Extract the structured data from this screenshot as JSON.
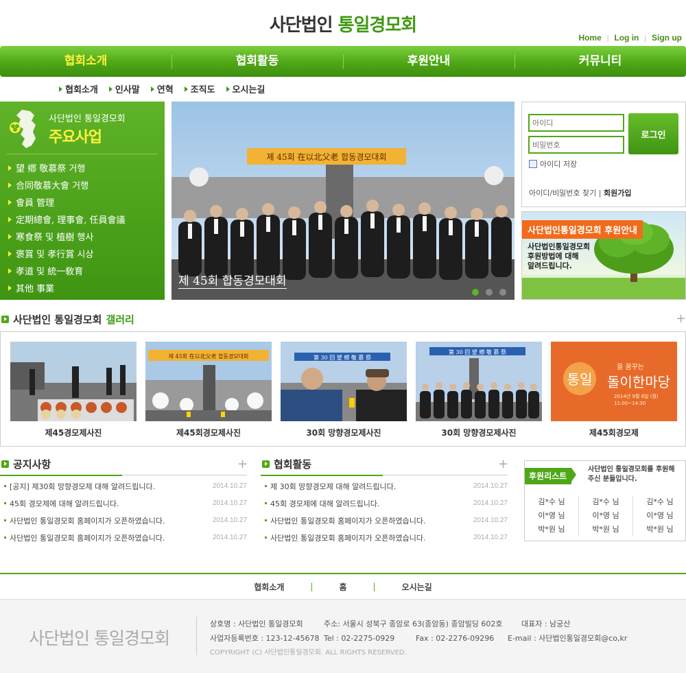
{
  "site": {
    "logo_dark": "사단법인",
    "logo_green": "통일경모회"
  },
  "toplinks": {
    "home": "Home",
    "login": "Log in",
    "signup": "Sign up"
  },
  "gnb": [
    {
      "label": "협회소개",
      "active": true
    },
    {
      "label": "협회활동",
      "active": false
    },
    {
      "label": "후원안내",
      "active": false
    },
    {
      "label": "커뮤니티",
      "active": false
    }
  ],
  "subnav": [
    "협회소개",
    "인사말",
    "연혁",
    "조직도",
    "오시는길"
  ],
  "business": {
    "subtitle": "사단법인 통일경모회",
    "title": "주요사업",
    "items": [
      "望 鄕 敬慕祭 거행",
      "合同敬慕大會 거행",
      "會員 管理",
      "定期總會, 理事會, 任員會議",
      "寒食祭 및 植樹 행사",
      "褒賞 및 孝行賞 시상",
      "孝道 및 統一敎育",
      "其他 事業"
    ]
  },
  "hero": {
    "caption": "제 45회 합동경모대회",
    "banner": "제 45회 在以北父老 합동경모대회",
    "active_slide": 1,
    "slides": 3
  },
  "login": {
    "id_placeholder": "아이디",
    "pw_placeholder": "비밀번호",
    "button": "로그인",
    "save_id": "아이디 저장",
    "find": "아이디/비밀번호 찾기",
    "join": "회원가입"
  },
  "sponsor": {
    "tag": "사단법인통일경모회 후원안내",
    "line1": "사단법인통일경모회",
    "line2": "후원방법에 대해",
    "line3": "알려드립니다."
  },
  "gallery": {
    "title_dark": "사단법인 통일경모회",
    "title_green": "갤러리",
    "items": [
      "제45경모제사진",
      "제45회경모제사진",
      "30회 망향경모제사진",
      "30회 망향경모제사진",
      "제45회경모제"
    ],
    "thumb_banner_45": "제 45회 在以北父老 합동경모대회",
    "thumb_banner_30": "第 30 回 望 鄕 敬 慕 祭",
    "thumb_poster_main": "통일",
    "thumb_poster_sub": "을 꿈꾸는",
    "thumb_poster_script": "돌이한마당",
    "thumb_poster_date": "2014년 9월 8일 (월)",
    "thumb_poster_time": "11:00~14:30"
  },
  "notice": {
    "title": "공지사항",
    "items": [
      {
        "title": "[공지] 제30회 망향경모제 대해 알려드립니다.",
        "date": "2014.10.27"
      },
      {
        "title": "45회 경모제에 대해 알려드립니다.",
        "date": "2014.10.27"
      },
      {
        "title": "사단법인 통일경모회 홈페이지가 오픈하였습니다.",
        "date": "2014.10.27"
      },
      {
        "title": "사단법인 통일경모회 홈페이지가 오픈하였습니다.",
        "date": "2014.10.27"
      }
    ]
  },
  "activity": {
    "title": "협회활동",
    "items": [
      {
        "title": "제 30회 망향경모제 대해 알려드립니다.",
        "date": "2014.10.27"
      },
      {
        "title": "45회 경모제에 대해 알려드립니다.",
        "date": "2014.10.27"
      },
      {
        "title": "사단법인 통일경모회 홈페이지가 오픈하였습니다.",
        "date": "2014.10.27"
      },
      {
        "title": "사단법인 통일경모회 홈페이지가 오픈하였습니다.",
        "date": "2014.10.27"
      }
    ]
  },
  "donor": {
    "tag": "후원리스트",
    "msg1": "사단법인 통일경모회를 후원해",
    "msg2": "주신 분들입니다.",
    "cols": [
      [
        "김*수 님",
        "이*영 님",
        "박*원 님"
      ],
      [
        "김*수 님",
        "이*영 님",
        "박*원 님"
      ],
      [
        "김*수 님",
        "이*영 님",
        "박*원 님"
      ]
    ]
  },
  "footer": {
    "nav": [
      "협회소개",
      "홈",
      "오시는길"
    ],
    "logo_a": "사단법인",
    "logo_b": "통일경모회",
    "company": "상호명 : 사단법인 통일경모회",
    "address": "주소: 서울시 성북구 종암로 63(종암동) 종암빌딩 602호",
    "ceo": "대표자 : 남궁산",
    "bizno": "사업자등록번호 : 123-12-45678",
    "tel": "Tel : 02-2275-0929",
    "fax": "Fax : 02-2276-09296",
    "email": "E-mail : 사단법인통일경모회@co,kr",
    "copyright": "COPYRIGHT (C) 사단법인통일경모회. ALL RIGHTS RESERVED."
  },
  "colors": {
    "brand": "#4fa716",
    "accent": "#fff23a",
    "orange": "#f26b1b"
  }
}
